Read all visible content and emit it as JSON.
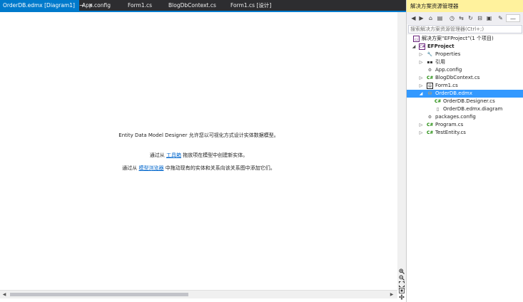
{
  "tabs": [
    {
      "label": "OrderDB.edmx [Diagram1]",
      "active": true
    },
    {
      "label": "App.config",
      "active": false
    },
    {
      "label": "Form1.cs",
      "active": false
    },
    {
      "label": "BlogDbContext.cs",
      "active": false
    },
    {
      "label": "Form1.cs [设计]",
      "active": false
    }
  ],
  "tab_pin_glyph": "⊸",
  "tab_close_glyph": "✕",
  "designer": {
    "line1": "Entity Data Model Designer 允许您以可视化方式设计实体数据模型。",
    "line2_prefix": "通过从 ",
    "line2_link": "工具箱",
    "line2_suffix": " 拖放项在模型中创建新实体。",
    "line3_prefix": "通过从 ",
    "line3_link": "模型浏览器",
    "line3_suffix": " 中拖动现有的实体和关系向该关系图中添加它们。"
  },
  "zoom_tools": [
    "zoom-in",
    "zoom-out",
    "zoom-to-fit",
    "zoom-100",
    "move"
  ],
  "solution_explorer": {
    "title": "解决方案资源管理器",
    "search_placeholder": "搜索解决方案资源管理器(Ctrl+;)",
    "toolbar_icons": [
      "back-icon",
      "forward-icon",
      "home-icon",
      "switch-views-icon",
      "pending-changes-icon",
      "sync-icon",
      "refresh-icon",
      "collapse-icon",
      "show-all-icon",
      "properties-icon",
      "preview-icon"
    ],
    "items": [
      {
        "label": "解决方案“EFProject”(1 个项目)",
        "icon": "solution-icon",
        "depth": 0,
        "expander": "",
        "bold": false,
        "selected": false
      },
      {
        "label": "EFProject",
        "icon": "csharp-project-icon",
        "depth": 0,
        "expander": "◢",
        "bold": true,
        "selected": false
      },
      {
        "label": "Properties",
        "icon": "wrench-icon",
        "depth": 1,
        "expander": "▷",
        "bold": false,
        "selected": false
      },
      {
        "label": "引用",
        "icon": "references-icon",
        "depth": 1,
        "expander": "▷",
        "bold": false,
        "selected": false
      },
      {
        "label": "App.config",
        "icon": "config-icon",
        "depth": 1,
        "expander": "",
        "bold": false,
        "selected": false
      },
      {
        "label": "BlogDbContext.cs",
        "icon": "csharp-file-icon",
        "depth": 1,
        "expander": "▷",
        "bold": false,
        "selected": false
      },
      {
        "label": "Form1.cs",
        "icon": "form-icon",
        "depth": 1,
        "expander": "▷",
        "bold": false,
        "selected": false
      },
      {
        "label": "OrderDB.edmx",
        "icon": "edmx-icon",
        "depth": 1,
        "expander": "◢",
        "bold": false,
        "selected": true
      },
      {
        "label": "OrderDB.Designer.cs",
        "icon": "csharp-file-icon",
        "depth": 2,
        "expander": "",
        "bold": false,
        "selected": false
      },
      {
        "label": "OrderDB.edmx.diagram",
        "icon": "diagram-file-icon",
        "depth": 2,
        "expander": "",
        "bold": false,
        "selected": false
      },
      {
        "label": "packages.config",
        "icon": "config-icon",
        "depth": 1,
        "expander": "",
        "bold": false,
        "selected": false
      },
      {
        "label": "Program.cs",
        "icon": "csharp-file-icon",
        "depth": 1,
        "expander": "▷",
        "bold": false,
        "selected": false
      },
      {
        "label": "TestEntity.cs",
        "icon": "csharp-file-icon",
        "depth": 1,
        "expander": "▷",
        "bold": false,
        "selected": false
      }
    ]
  },
  "colors": {
    "accent": "#007acc",
    "tabstrip": "#2d2d30",
    "panel_title": "#fff29d",
    "selection": "#3399ff",
    "link": "#0066cc"
  }
}
